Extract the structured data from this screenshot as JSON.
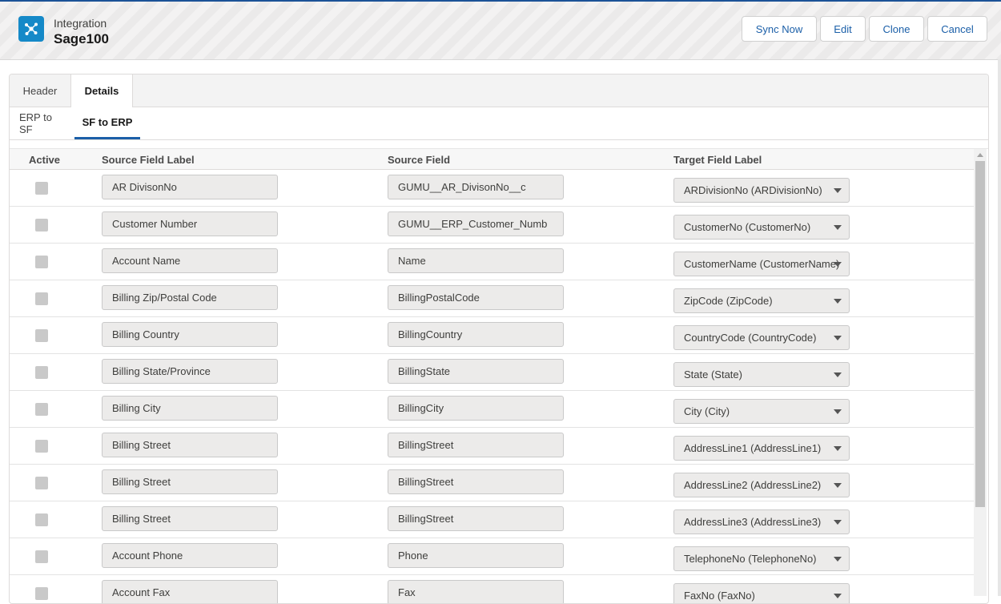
{
  "header": {
    "object_label": "Integration",
    "record_name": "Sage100",
    "buttons": {
      "sync_now": "Sync Now",
      "edit": "Edit",
      "clone": "Clone",
      "cancel": "Cancel"
    }
  },
  "tabs": {
    "header": "Header",
    "details": "Details",
    "active": "Details"
  },
  "subtabs": {
    "erp_to_sf": "ERP to SF",
    "sf_to_erp": "SF to ERP",
    "active": "SF to ERP"
  },
  "table": {
    "columns": {
      "active": "Active",
      "source_field_label": "Source Field Label",
      "source_field": "Source Field",
      "target_field_label": "Target Field Label"
    },
    "rows": [
      {
        "active": false,
        "source_label": "AR DivisonNo",
        "source_field": "GUMU__AR_DivisonNo__c",
        "target": "ARDivisionNo (ARDivisionNo)"
      },
      {
        "active": false,
        "source_label": "Customer Number",
        "source_field": "GUMU__ERP_Customer_Numb",
        "target": "CustomerNo (CustomerNo)"
      },
      {
        "active": false,
        "source_label": "Account Name",
        "source_field": "Name",
        "target": "CustomerName (CustomerName)"
      },
      {
        "active": false,
        "source_label": "Billing Zip/Postal Code",
        "source_field": "BillingPostalCode",
        "target": "ZipCode (ZipCode)"
      },
      {
        "active": false,
        "source_label": "Billing Country",
        "source_field": "BillingCountry",
        "target": "CountryCode (CountryCode)"
      },
      {
        "active": false,
        "source_label": "Billing State/Province",
        "source_field": "BillingState",
        "target": "State (State)"
      },
      {
        "active": false,
        "source_label": "Billing City",
        "source_field": "BillingCity",
        "target": "City (City)"
      },
      {
        "active": false,
        "source_label": "Billing Street",
        "source_field": "BillingStreet",
        "target": "AddressLine1 (AddressLine1)"
      },
      {
        "active": false,
        "source_label": "Billing Street",
        "source_field": "BillingStreet",
        "target": "AddressLine2 (AddressLine2)"
      },
      {
        "active": false,
        "source_label": "Billing Street",
        "source_field": "BillingStreet",
        "target": "AddressLine3 (AddressLine3)"
      },
      {
        "active": false,
        "source_label": "Account Phone",
        "source_field": "Phone",
        "target": "TelephoneNo (TelephoneNo)"
      },
      {
        "active": false,
        "source_label": "Account Fax",
        "source_field": "Fax",
        "target": "FaxNo (FaxNo)"
      }
    ]
  },
  "icons": {
    "app": "integration-hub-icon",
    "dropdown": "chevron-down-icon"
  },
  "colors": {
    "brand": "#1589c8",
    "link": "#1b5fa8",
    "active_tab_underline": "#1b5fa8"
  }
}
